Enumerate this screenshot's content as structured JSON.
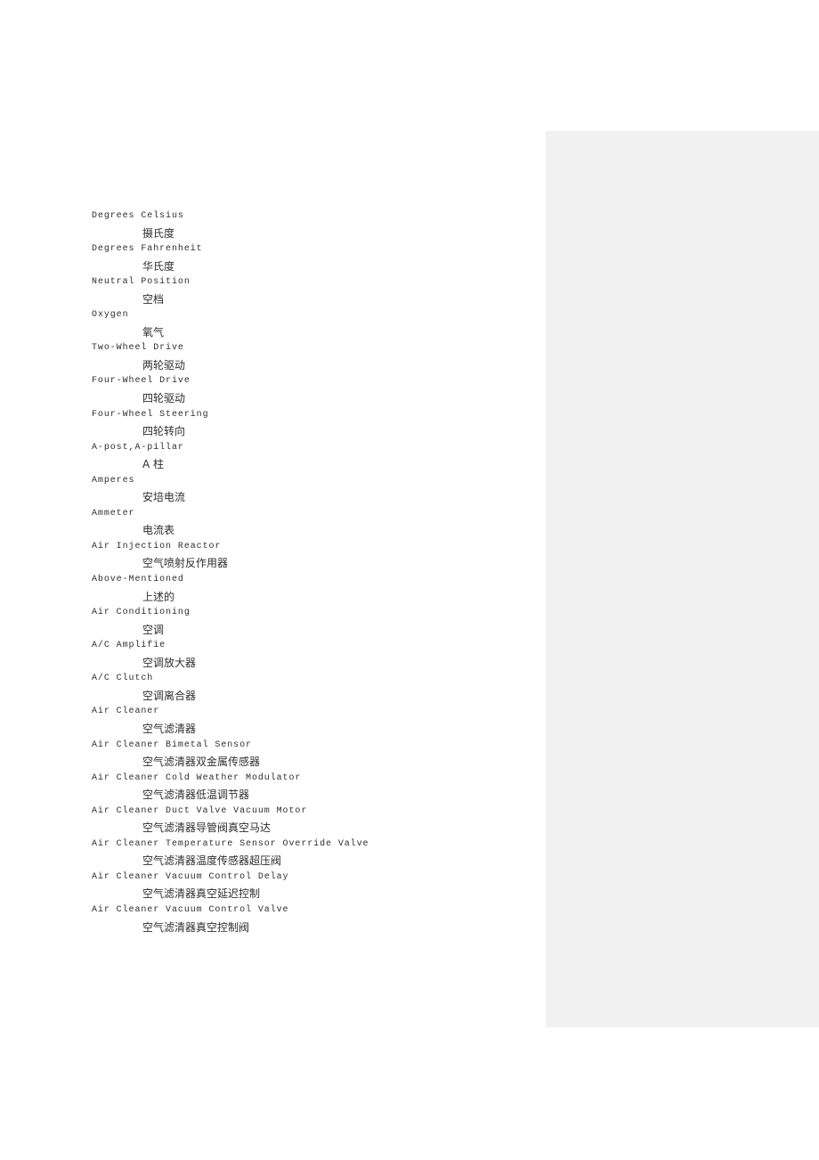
{
  "page": {
    "background_color": "#ffffff",
    "text_color": "#2e2e2e",
    "panel_color": "#f1f1f1"
  },
  "side_panel": {
    "label": ""
  },
  "glossary": {
    "entries": [
      {
        "term": "Degrees Celsius",
        "gloss": "摄氏度"
      },
      {
        "term": "Degrees Fahrenheit",
        "gloss": "华氏度"
      },
      {
        "term": "Neutral Position",
        "gloss": "空档"
      },
      {
        "term": "Oxygen",
        "gloss": "氧气"
      },
      {
        "term": "Two-Wheel Drive",
        "gloss": "两轮驱动"
      },
      {
        "term": "Four-Wheel Drive",
        "gloss": "四轮驱动"
      },
      {
        "term": "Four-Wheel Steering",
        "gloss": "四轮转向"
      },
      {
        "term": "A-post,A-pillar",
        "gloss": "A 柱"
      },
      {
        "term": "Amperes",
        "gloss": "安培电流"
      },
      {
        "term": "Ammeter",
        "gloss": "电流表"
      },
      {
        "term": "Air Injection Reactor",
        "gloss": "空气喷射反作用器"
      },
      {
        "term": "Above-Mentioned",
        "gloss": "上述的"
      },
      {
        "term": "Air Conditioning",
        "gloss": "空调"
      },
      {
        "term": "A/C Amplifie",
        "gloss": "空调放大器"
      },
      {
        "term": "A/C Clutch",
        "gloss": "空调离合器"
      },
      {
        "term": "Air Cleaner",
        "gloss": "空气滤清器"
      },
      {
        "term": "Air Cleaner Bimetal Sensor",
        "gloss": "空气滤清器双金属传感器"
      },
      {
        "term": "Air Cleaner Cold Weather Modulator",
        "gloss": "空气滤清器低温调节器"
      },
      {
        "term": "Air Cleaner Duct Valve Vacuum Motor",
        "gloss": "空气滤清器导管阀真空马达"
      },
      {
        "term": "Air Cleaner Temperature Sensor Override Valve",
        "gloss": "空气滤清器温度传感器超压阀"
      },
      {
        "term": "Air Cleaner Vacuum Control Delay",
        "gloss": "空气滤清器真空延迟控制"
      },
      {
        "term": "Air Cleaner Vacuum Control Valve",
        "gloss": "空气滤清器真空控制阀"
      }
    ]
  }
}
